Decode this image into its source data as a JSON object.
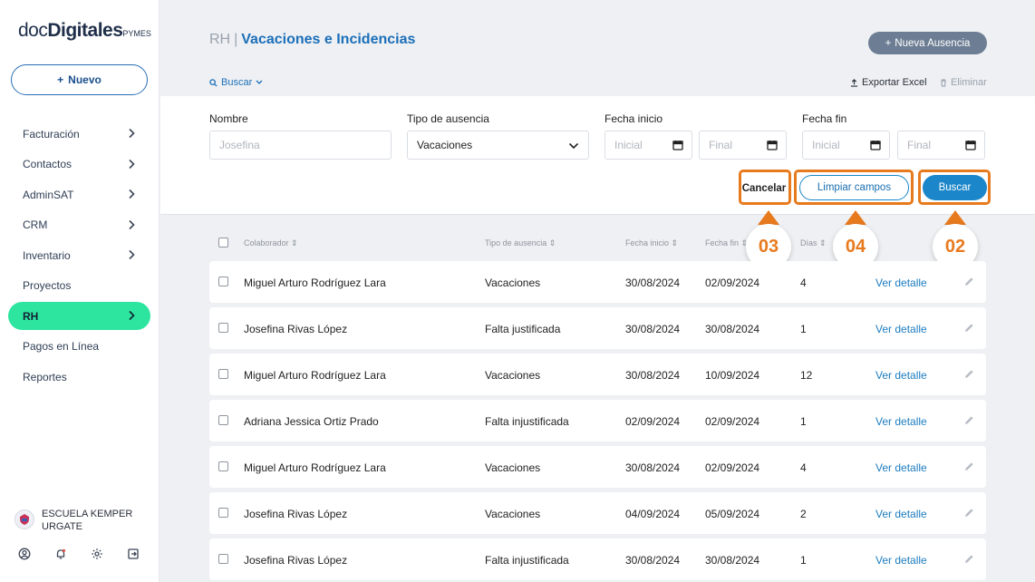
{
  "logo": {
    "doc": "doc",
    "digitales": "Digitales",
    "pymes": "PYMES"
  },
  "sidebar": {
    "new_label": "Nuevo",
    "items": [
      {
        "label": "Facturación",
        "chevron": true
      },
      {
        "label": "Contactos",
        "chevron": true
      },
      {
        "label": "AdminSAT",
        "chevron": true
      },
      {
        "label": "CRM",
        "chevron": true
      },
      {
        "label": "Inventario",
        "chevron": true
      },
      {
        "label": "Proyectos",
        "chevron": false
      },
      {
        "label": "RH",
        "chevron": true,
        "active": true
      },
      {
        "label": "Pagos en Línea",
        "chevron": false
      },
      {
        "label": "Reportes",
        "chevron": false
      }
    ],
    "company_line1": "ESCUELA KEMPER",
    "company_line2": "URGATE",
    "bottom_icons": [
      "user-circle-icon",
      "bell-icon",
      "gear-icon",
      "logout-icon"
    ]
  },
  "header": {
    "section": "RH",
    "separator": "|",
    "page_title": "Vacaciones e Incidencias",
    "new_absence_label": "Nueva Ausencia",
    "search_toggle_label": "Buscar",
    "export_label": "Exportar Excel",
    "delete_label": "Eliminar"
  },
  "filters": {
    "name_label": "Nombre",
    "name_placeholder": "Josefina",
    "type_label": "Tipo de ausencia",
    "type_value": "Vacaciones",
    "start_label": "Fecha inicio",
    "end_label": "Fecha fin",
    "initial_placeholder": "Inicial",
    "final_placeholder": "Final",
    "cancel_label": "Cancelar",
    "clear_label": "Limpiar campos",
    "search_label": "Buscar"
  },
  "callouts": {
    "cancel": "03",
    "clear": "04",
    "search": "02"
  },
  "table": {
    "columns": [
      "Colaborador",
      "Tipo de ausencia",
      "Fecha inicio",
      "Fecha fin",
      "Días"
    ],
    "detail_label": "Ver detalle",
    "rows": [
      {
        "name": "Miguel Arturo Rodríguez Lara",
        "type": "Vacaciones",
        "start": "30/08/2024",
        "end": "02/09/2024",
        "days": "4"
      },
      {
        "name": "Josefina Rivas López",
        "type": "Falta justificada",
        "start": "30/08/2024",
        "end": "30/08/2024",
        "days": "1"
      },
      {
        "name": "Miguel Arturo Rodríguez Lara",
        "type": "Vacaciones",
        "start": "30/08/2024",
        "end": "10/09/2024",
        "days": "12"
      },
      {
        "name": "Adriana Jessica Ortiz Prado",
        "type": "Falta injustificada",
        "start": "02/09/2024",
        "end": "02/09/2024",
        "days": "1"
      },
      {
        "name": "Miguel Arturo Rodríguez Lara",
        "type": "Vacaciones",
        "start": "30/08/2024",
        "end": "02/09/2024",
        "days": "4"
      },
      {
        "name": "Josefina Rivas López",
        "type": "Vacaciones",
        "start": "04/09/2024",
        "end": "05/09/2024",
        "days": "2"
      },
      {
        "name": "Josefina Rivas López",
        "type": "Falta injustificada",
        "start": "30/08/2024",
        "end": "30/08/2024",
        "days": "1"
      }
    ]
  },
  "colors": {
    "accent": "#1c6fb9",
    "active_nav": "#2ee5a0",
    "highlight": "#e87a1e",
    "buscar_button": "#1b86c9"
  }
}
